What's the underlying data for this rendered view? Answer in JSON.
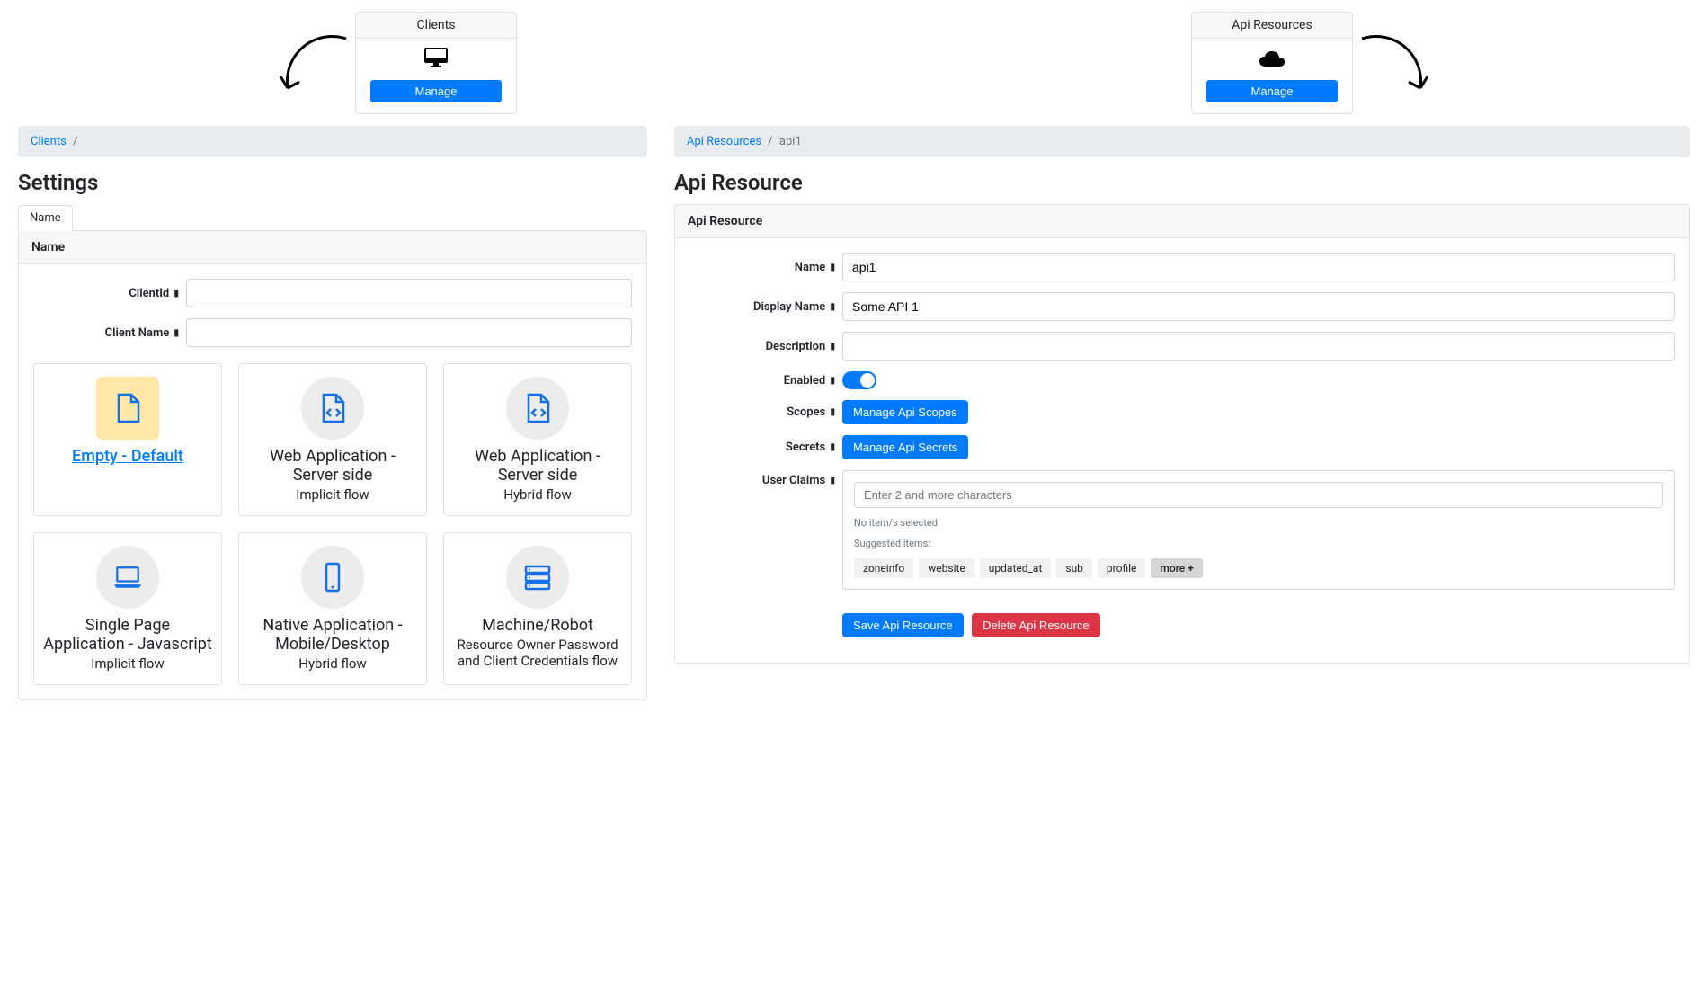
{
  "cards": {
    "clients": {
      "title": "Clients",
      "button": "Manage"
    },
    "api_resources": {
      "title": "Api Resources",
      "button": "Manage"
    }
  },
  "left": {
    "breadcrumb_link": "Clients",
    "page_title": "Settings",
    "tab_name": "Name",
    "panel_title": "Name",
    "client_id_label": "ClientId",
    "client_name_label": "Client Name",
    "client_id_value": "",
    "client_name_value": "",
    "templates": [
      {
        "title": "Empty - Default",
        "subtitle": "",
        "selected": true,
        "icon": "file"
      },
      {
        "title": "Web Application - Server side",
        "subtitle": "Implicit flow",
        "selected": false,
        "icon": "filecode"
      },
      {
        "title": "Web Application - Server side",
        "subtitle": "Hybrid flow",
        "selected": false,
        "icon": "filecode"
      },
      {
        "title": "Single Page Application - Javascript",
        "subtitle": "Implicit flow",
        "selected": false,
        "icon": "laptop"
      },
      {
        "title": "Native Application - Mobile/Desktop",
        "subtitle": "Hybrid flow",
        "selected": false,
        "icon": "mobile"
      },
      {
        "title": "Machine/Robot",
        "subtitle": "Resource Owner Password and Client Credentials flow",
        "selected": false,
        "icon": "server"
      }
    ]
  },
  "right": {
    "breadcrumb_link": "Api Resources",
    "breadcrumb_current": "api1",
    "page_title": "Api Resource",
    "panel_title": "Api Resource",
    "labels": {
      "name": "Name",
      "display_name": "Display Name",
      "description": "Description",
      "enabled": "Enabled",
      "scopes": "Scopes",
      "secrets": "Secrets",
      "user_claims": "User Claims"
    },
    "values": {
      "name": "api1",
      "display_name": "Some API 1",
      "description": "",
      "enabled": true
    },
    "buttons": {
      "manage_scopes": "Manage Api Scopes",
      "manage_secrets": "Manage Api Secrets",
      "save": "Save Api Resource",
      "delete": "Delete Api Resource"
    },
    "claims": {
      "placeholder": "Enter 2 and more characters",
      "empty_text": "No item/s selected",
      "suggested_label": "Suggested items:",
      "suggested": [
        "zoneinfo",
        "website",
        "updated_at",
        "sub",
        "profile"
      ],
      "more_label": "more"
    }
  }
}
